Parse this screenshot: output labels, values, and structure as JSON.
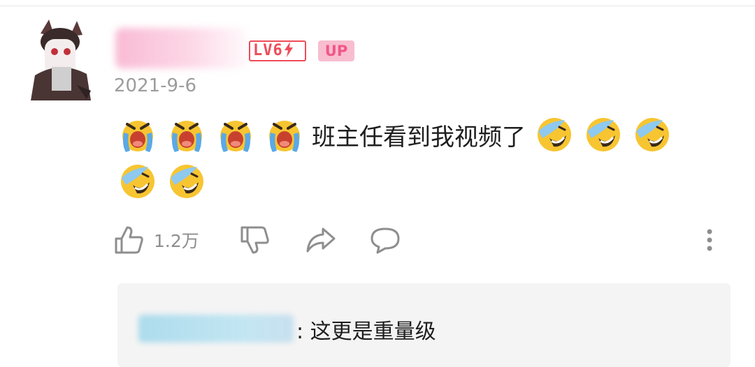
{
  "comment": {
    "username": "",
    "level": "LV6",
    "up_badge": "UP",
    "date": "2021-9-6",
    "text": "班主任看到我视频了",
    "emojis_before": [
      "crying-emoji",
      "crying-emoji",
      "crying-emoji",
      "crying-emoji"
    ],
    "emojis_after": [
      "laughing-tears-emoji",
      "laughing-tears-emoji",
      "laughing-tears-emoji",
      "laughing-tears-emoji",
      "laughing-tears-emoji"
    ]
  },
  "actions": {
    "like_count": "1.2万",
    "icons": [
      "thumbs-up-icon",
      "thumbs-down-icon",
      "share-icon",
      "comment-icon",
      "more-icon"
    ]
  },
  "reply": {
    "username": "",
    "text": ": 这更是重量级"
  },
  "colors": {
    "level_red": "#ee4c59",
    "up_pink_bg": "#f8bed0",
    "up_pink_text": "#f15788",
    "icon_gray": "#8e8e8e",
    "reply_bg": "#f4f4f4"
  }
}
